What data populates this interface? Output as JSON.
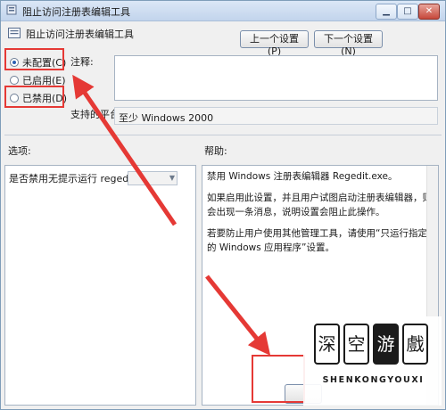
{
  "window": {
    "title": "阻止访问注册表编辑工具",
    "controls": {
      "minimize": "▁",
      "maximize": "□",
      "close": "✕"
    }
  },
  "header": {
    "policy_name": "阻止访问注册表编辑工具"
  },
  "nav": {
    "prev_label": "上一个设置(P)",
    "next_label": "下一个设置(N)"
  },
  "state_options": [
    {
      "label": "未配置(C)",
      "checked": true
    },
    {
      "label": "已启用(E)",
      "checked": false
    },
    {
      "label": "已禁用(D)",
      "checked": false
    }
  ],
  "comment": {
    "label": "注释:",
    "value": ""
  },
  "supported": {
    "label": "支持的平台:",
    "value": "至少 Windows 2000"
  },
  "options": {
    "heading": "选项:",
    "item_label": "是否禁用无提示运行 regedit ?",
    "combo_value": ""
  },
  "help": {
    "heading": "帮助:",
    "paragraphs": [
      "禁用 Windows 注册表编辑器 Regedit.exe。",
      "如果启用此设置，并且用户试图启动注册表编辑器，则会出现一条消息，说明设置会阻止此操作。",
      "若要防止用户使用其他管理工具，请使用“只运行指定的 Windows 应用程序”设置。"
    ]
  },
  "watermark": {
    "chars": [
      "深",
      "空",
      "游",
      "戲"
    ],
    "latin": "SHENKONGYOUXI"
  },
  "colors": {
    "annotation": "#e53935",
    "accent": "#2b5fb3"
  }
}
